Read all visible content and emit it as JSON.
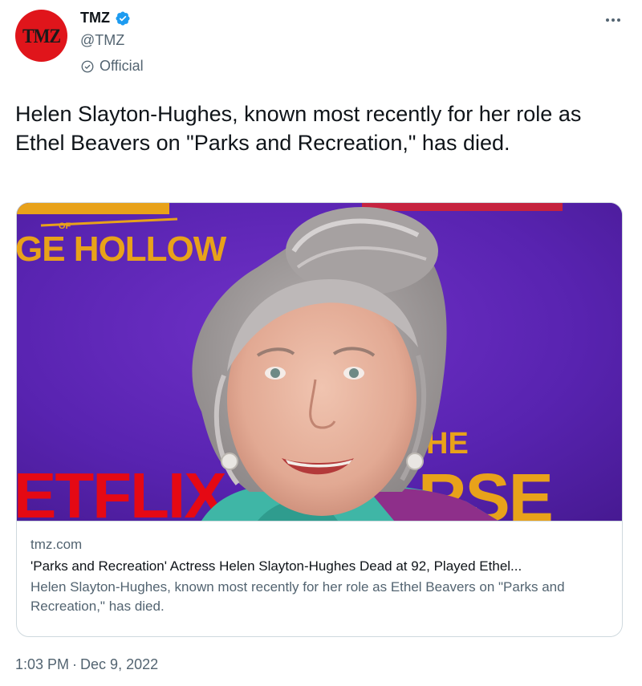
{
  "author": {
    "display_name": "TMZ",
    "handle": "@TMZ",
    "label": "Official",
    "avatar_text": "TMZ",
    "avatar_color": "#e0151b",
    "verified_color": "#1d9bf0"
  },
  "tweet": {
    "text": "Helen Slayton-Hughes, known most recently for her role as Ethel Beavers on \"Parks and Recreation,\" has died."
  },
  "card": {
    "image_texts": {
      "top_left_line1": "OF",
      "top_left_line2": "GE HOLLOW",
      "bottom_left": "ETFLIX",
      "bottom_right_top": "HE",
      "bottom_right": "RSE"
    },
    "domain": "tmz.com",
    "title": "'Parks and Recreation' Actress Helen Slayton-Hughes Dead at 92, Played Ethel...",
    "description": "Helen Slayton-Hughes, known most recently for her role as Ethel Beavers on \"Parks and Recreation,\" has died."
  },
  "meta": {
    "time": "1:03 PM",
    "separator": "·",
    "date": "Dec 9, 2022"
  },
  "icons": {
    "more": "more-options-icon",
    "verified": "verified-badge-icon",
    "official": "official-label-icon"
  }
}
